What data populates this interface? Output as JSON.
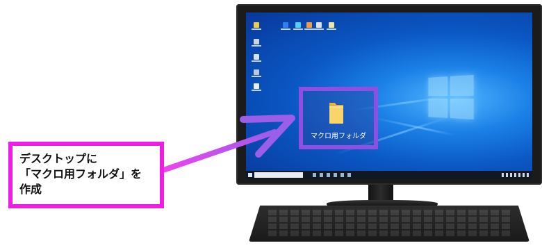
{
  "desktop": {
    "folder": {
      "name": "マクロ用フォルダ",
      "icon": "folder-icon"
    },
    "wallpaper": "windows-10-hero",
    "accent_color": "#8f4fe3"
  },
  "callout": {
    "lines": [
      "デスクトップに",
      "「マクロ用フォルダ」を",
      "作成"
    ],
    "border_color": "#ee1fe5"
  }
}
